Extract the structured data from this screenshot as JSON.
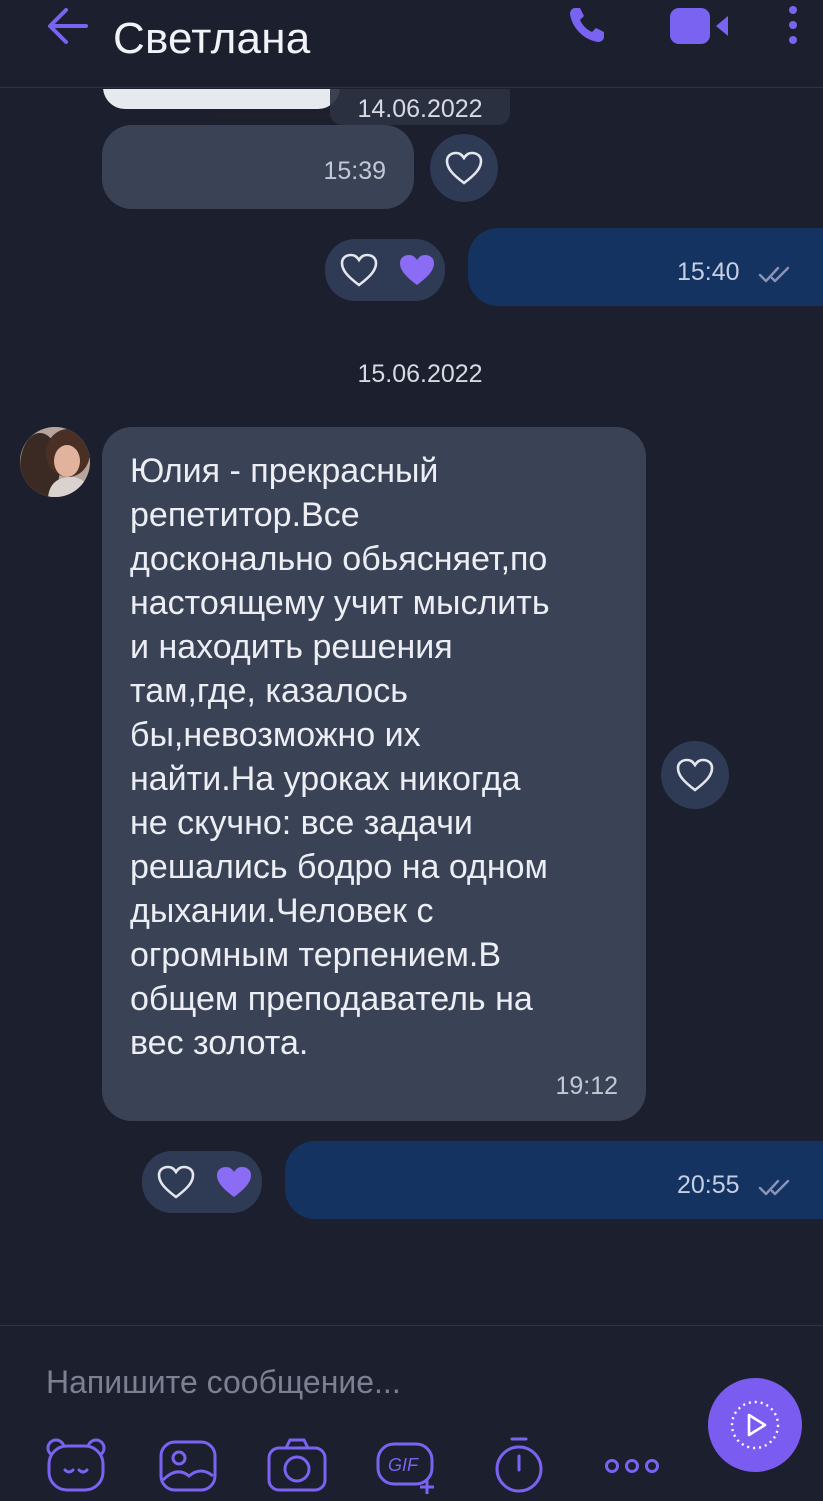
{
  "header": {
    "contact_name": "Светлана"
  },
  "chat": {
    "date_1": "14.06.2022",
    "date_2": "15.06.2022",
    "messages": [
      {
        "direction": "incoming",
        "time": "15:39"
      },
      {
        "direction": "outgoing",
        "time": "15:40"
      },
      {
        "direction": "incoming",
        "text": "Юлия     - прекрасный\nрепетитор.Все\nдосконально обьясняет,по\nнастоящему учит мыслить\nи находить решения\nтам,где, казалось\nбы,невозможно их\nнайти.На уроках никогда\nне скучно: все задачи\nрешались бодро на одном\nдыхании.Человек с\nогромным терпением.В\nобщем преподаватель на\nвес золота.",
        "time": "19:12"
      },
      {
        "direction": "outgoing",
        "time": "20:55"
      }
    ]
  },
  "composer": {
    "placeholder": "Напишите сообщение..."
  },
  "toolbar": {
    "gif_label": "GIF"
  },
  "colors": {
    "background": "#1b1f2e",
    "incoming_bubble": "#3a4356",
    "outgoing_bubble": "#143361",
    "accent": "#7b5cf0"
  },
  "icons": [
    "back-arrow-icon",
    "phone-icon",
    "video-camera-icon",
    "more-vertical-icon",
    "heart-outline-icon",
    "heart-filled-icon",
    "double-check-icon",
    "sticker-bear-icon",
    "gallery-icon",
    "camera-icon",
    "gif-icon",
    "timer-icon",
    "more-horizontal-icon",
    "send-play-icon"
  ]
}
